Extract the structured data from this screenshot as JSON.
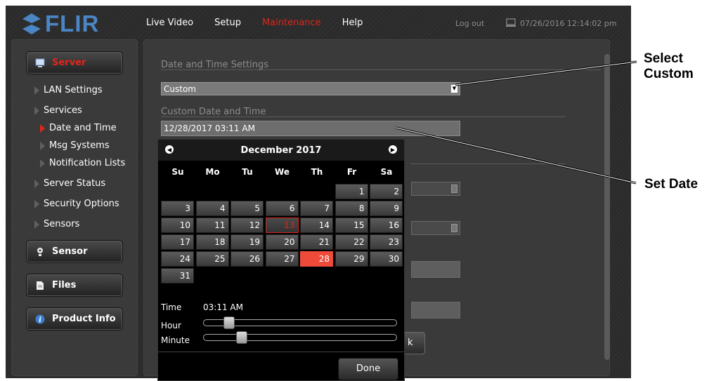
{
  "header": {
    "logo_text": "FLIR",
    "nav": [
      "Live Video",
      "Setup",
      "Maintenance",
      "Help"
    ],
    "active_nav": "Maintenance",
    "logout": "Log out",
    "datetime": "07/26/2016 12:14:02 pm"
  },
  "sidebar": {
    "server_label": "Server",
    "items": [
      "LAN Settings",
      "Services",
      "Date and Time",
      "Msg Systems",
      "Notification Lists",
      "Server Status",
      "Security Options",
      "Sensors"
    ],
    "sensor_label": "Sensor",
    "files_label": "Files",
    "product_info_label": "Product Info"
  },
  "main": {
    "section1_title": "Date and Time Settings",
    "select_value": "Custom",
    "section2_title": "Custom Date and Time",
    "datetime_value": "12/28/2017 03:11 AM",
    "partial_button_text": "k"
  },
  "datepicker": {
    "month_title": "December 2017",
    "weekdays": [
      "Su",
      "Mo",
      "Tu",
      "We",
      "Th",
      "Fr",
      "Sa"
    ],
    "today": 13,
    "selected": 28,
    "time_label": "Time",
    "time_value": "03:11 AM",
    "hour_label": "Hour",
    "minute_label": "Minute",
    "hour_level": 0.11,
    "minute_level": 0.18,
    "done_label": "Done"
  },
  "annotations": {
    "select_custom": "Select\nCustom",
    "set_date": "Set Date"
  },
  "colors": {
    "accent_red": "#d9261c",
    "selected_day": "#f04a3a",
    "logo_blue": "#4a86c4"
  }
}
